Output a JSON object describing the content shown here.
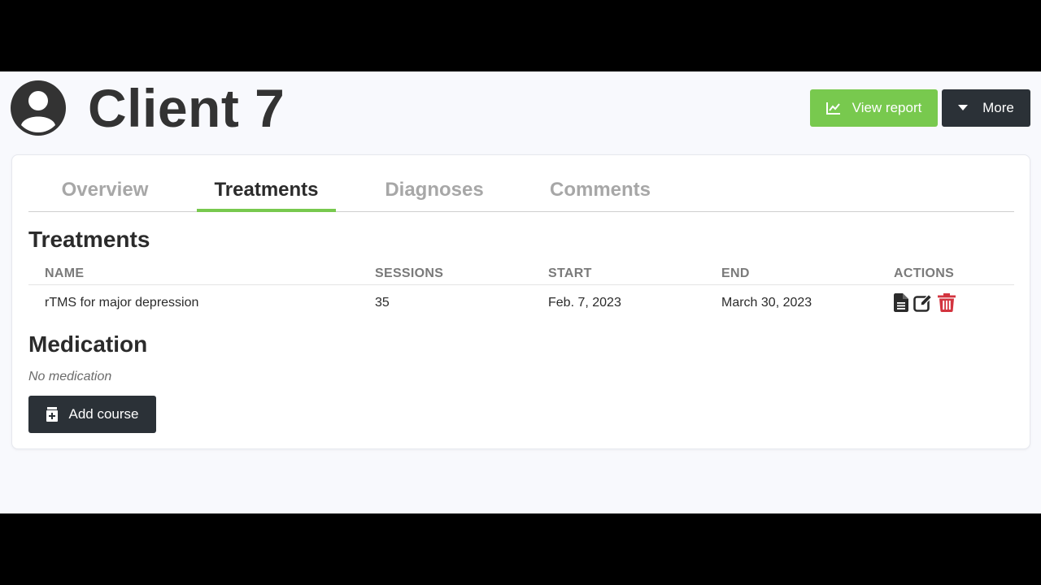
{
  "page": {
    "client_title": "Client 7"
  },
  "header_actions": {
    "view_report_label": "View report",
    "more_label": "More"
  },
  "tabs": [
    {
      "label": "Overview",
      "active": false
    },
    {
      "label": "Treatments",
      "active": true
    },
    {
      "label": "Diagnoses",
      "active": false
    },
    {
      "label": "Comments",
      "active": false
    }
  ],
  "treatments": {
    "title": "Treatments",
    "columns": [
      "NAME",
      "SESSIONS",
      "START",
      "END",
      "ACTIONS"
    ],
    "rows": [
      {
        "name": "rTMS for major depression",
        "sessions": "35",
        "start": "Feb. 7, 2023",
        "end": "March 30, 2023"
      }
    ]
  },
  "medication": {
    "title": "Medication",
    "empty_text": "No medication",
    "add_label": "Add course"
  },
  "icons": {
    "avatar": "user-circle-icon",
    "report": "chart-line-icon",
    "more": "caret-down-icon",
    "view": "file-text-icon",
    "edit": "edit-icon",
    "delete": "trash-icon",
    "add": "medical-plus-icon"
  },
  "colors": {
    "accent": "#78c94e",
    "dark": "#2b3137",
    "danger": "#d3343f"
  }
}
